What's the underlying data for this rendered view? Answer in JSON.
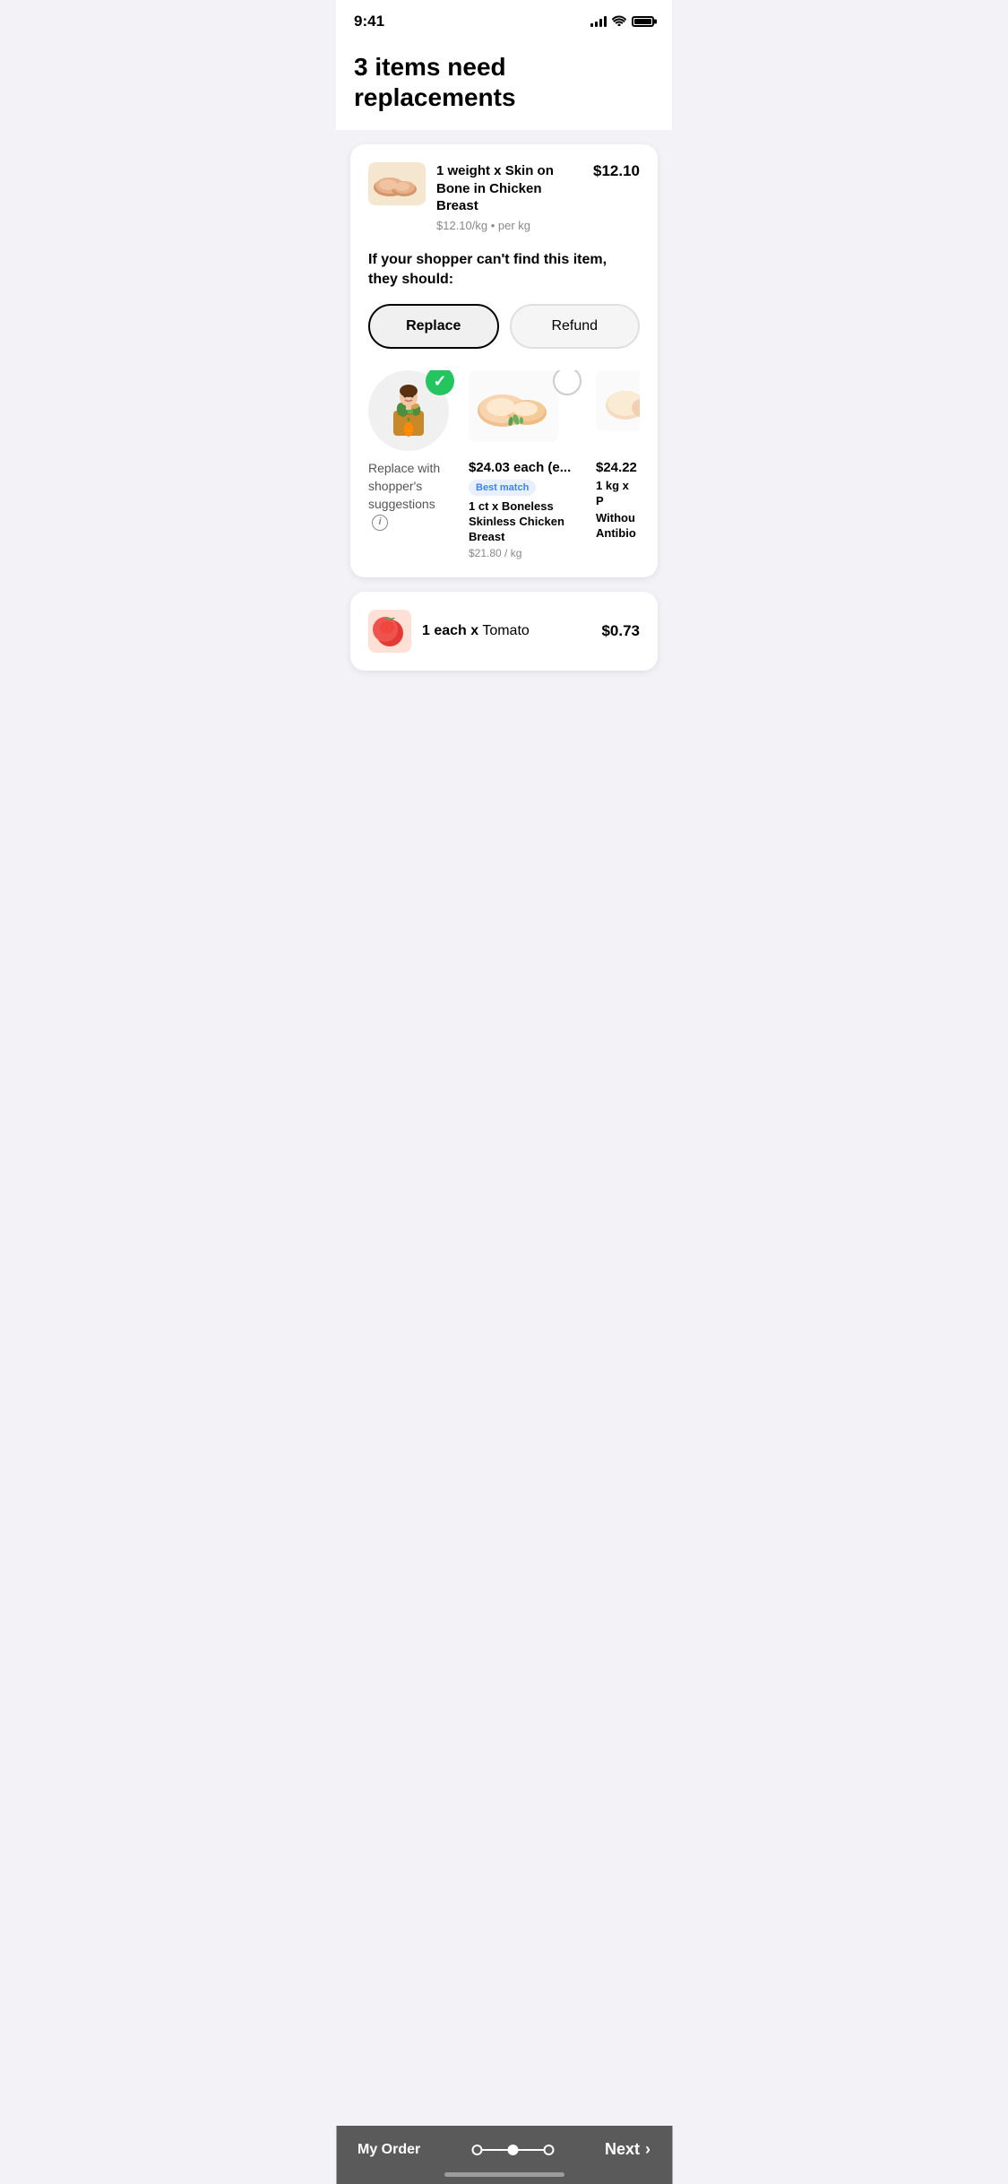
{
  "statusBar": {
    "time": "9:41"
  },
  "header": {
    "title": "3 items need replacements"
  },
  "card1": {
    "item": {
      "quantity": "1 weight x",
      "name": "Skin on Bone in Chicken Breast",
      "pricePer": "$12.10/kg • per kg",
      "price": "$12.10"
    },
    "message": "If your shopper can't find this item, they should:",
    "buttons": {
      "replace": "Replace",
      "refund": "Refund"
    },
    "shopperOption": {
      "label": "Replace with shopper's suggestions"
    },
    "suggestion1": {
      "price": "$24.03 each (e...",
      "badge": "Best match",
      "quantity": "1 ct x",
      "name": "Boneless Skinless Chicken Breast",
      "pricePerKg": "$21.80 / kg"
    },
    "suggestion2": {
      "price": "$24.22",
      "detail": "1 kg x P",
      "namePartial": "Withou Antibio"
    }
  },
  "card2": {
    "quantity": "1 each x",
    "name": "Tomato",
    "price": "$0.73"
  },
  "bottomBar": {
    "myOrder": "My Order",
    "next": "Next"
  }
}
